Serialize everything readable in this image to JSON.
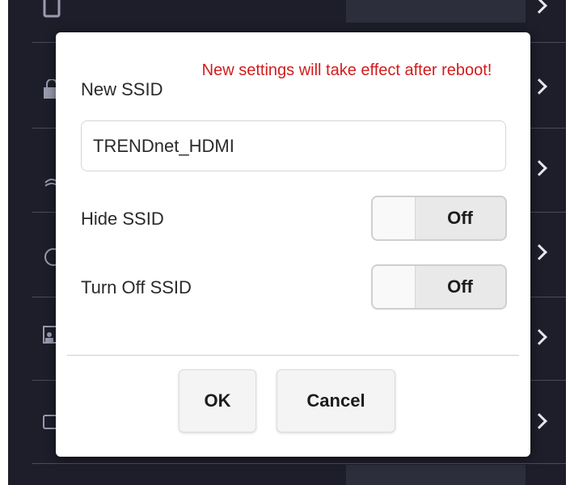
{
  "dialog": {
    "new_ssid_label": "New SSID",
    "warning": "New settings will take effect after reboot!",
    "ssid_value": "TRENDnet_HDMI",
    "hide_ssid_label": "Hide SSID",
    "hide_ssid_state": "Off",
    "turn_off_ssid_label": "Turn Off SSID",
    "turn_off_ssid_state": "Off",
    "ok_label": "OK",
    "cancel_label": "Cancel"
  },
  "colors": {
    "warning": "#d21c1c",
    "background_panel": "#1d1e2a",
    "dialog": "#ffffff"
  },
  "background_icons": [
    "tablet-icon",
    "lock-icon",
    "antenna-icon",
    "clock-icon",
    "user-screen-icon",
    "device-icon"
  ]
}
